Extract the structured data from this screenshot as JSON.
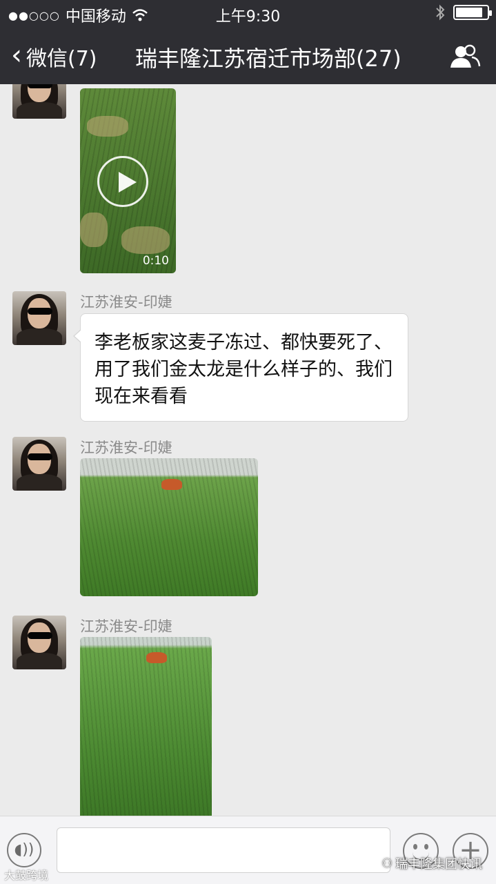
{
  "status_bar": {
    "signal": "●●○○○",
    "carrier": "中国移动",
    "time": "上午9:30",
    "bluetooth_icon": "bluetooth-icon",
    "battery_icon": "battery-icon"
  },
  "nav": {
    "back_label": "微信(7)",
    "title": "瑞丰隆江苏宿迁市场部(27)",
    "group_icon": "group-members-icon"
  },
  "messages": [
    {
      "type": "video",
      "duration": "0:10"
    },
    {
      "type": "text",
      "sender": "江苏淮安-印婕",
      "text": "李老板家这麦子冻过、都快要死了、用了我们金太龙是什么样子的、我们现在来看看"
    },
    {
      "type": "image",
      "sender": "江苏淮安-印婕"
    },
    {
      "type": "image",
      "sender": "江苏淮安-印婕"
    }
  ],
  "input_bar": {
    "voice_icon": "voice-icon",
    "text_value": "",
    "emoji_icon": "emoji-icon",
    "plus_icon": "plus-icon"
  },
  "watermarks": {
    "left": "大鼓跨境",
    "right": "瑞丰隆集团快讯"
  },
  "colors": {
    "header_bg": "#2e2e33",
    "chat_bg": "#ebebeb",
    "bubble_bg": "#ffffff"
  }
}
